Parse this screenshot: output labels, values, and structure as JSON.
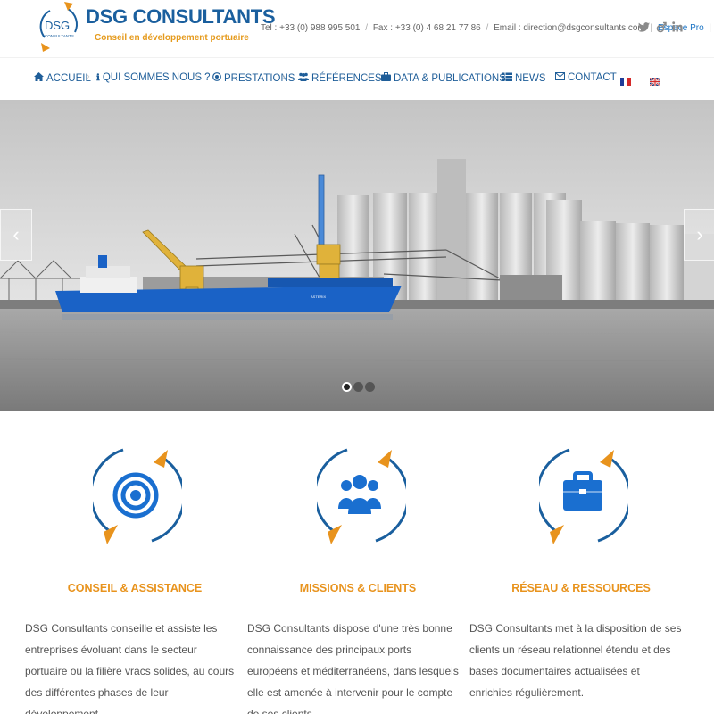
{
  "brand": {
    "logo_text": "DSG",
    "logo_sub": "CONSULTANTS",
    "name": "DSG CONSULTANTS",
    "tagline": "Conseil en développement portuaire"
  },
  "contact": {
    "phone": "Tel : +33 (0) 988 995 501",
    "fax": "Fax : +33 (0) 4 68 21 77 86",
    "email": "Email : direction@dsgconsultants.com",
    "espace_pro": "Espace Pro"
  },
  "social": [
    "twitter-icon",
    "gender-icon",
    "linkedin-icon"
  ],
  "nav": {
    "items": [
      {
        "label": "ACCUEIL",
        "icon": "home-icon"
      },
      {
        "label": "QUI SOMMES NOUS ?",
        "icon": "info-icon"
      },
      {
        "label": "PRESTATIONS",
        "icon": "target-icon"
      },
      {
        "label": "RÉFÉRENCES",
        "icon": "users-icon"
      },
      {
        "label": "DATA & PUBLICATIONS",
        "icon": "briefcase-icon"
      },
      {
        "label": "NEWS",
        "icon": "list-icon"
      },
      {
        "label": "CONTACT",
        "icon": "envelope-icon"
      }
    ],
    "flags": [
      "flag-fr-icon",
      "flag-uk-icon"
    ]
  },
  "slider": {
    "total_slides": 3,
    "active_slide": 1,
    "ship_name": "ASTERIX"
  },
  "features": [
    {
      "title": "CONSEIL & ASSISTANCE",
      "icon": "target-icon",
      "text": "DSG Consultants conseille et assiste les entreprises évoluant dans le secteur portuaire ou la filière vracs solides, au cours des différentes phases de leur développement."
    },
    {
      "title": "MISSIONS & CLIENTS",
      "icon": "users-icon",
      "text": "DSG Consultants dispose d'une très bonne connaissance des principaux ports  européens et méditerranéens, dans lesquels elle est amenée à intervenir pour le compte de ses clients."
    },
    {
      "title": "RÉSEAU & RESSOURCES",
      "icon": "briefcase-icon",
      "text": "DSG Consultants met à la disposition de ses clients un réseau relationnel étendu et des bases documentaires actualisées et enrichies régulièrement."
    }
  ],
  "colors": {
    "brand_blue": "#1a5f9e",
    "accent_orange": "#e8931d",
    "icon_blue": "#1a6fd0"
  }
}
